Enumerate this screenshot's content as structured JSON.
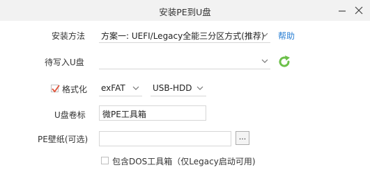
{
  "window": {
    "title": "安装PE到U盘",
    "minimize_glyph": "−",
    "close_glyph": "✕"
  },
  "install_method": {
    "label": "安装方法",
    "value": "方案一: UEFI/Legacy全能三分区方式(推荐)",
    "help": "帮助"
  },
  "target_usb": {
    "label": "待写入U盘",
    "value": "",
    "refresh_icon": "refresh-icon"
  },
  "format": {
    "label": "格式化",
    "checked": true,
    "filesystem": "exFAT",
    "mode": "USB-HDD"
  },
  "volume_label": {
    "label": "U盘卷标",
    "value": "微PE工具箱"
  },
  "wallpaper": {
    "label": "PE壁纸(可选)",
    "value": "",
    "browse": "..."
  },
  "dos_tools": {
    "checked": false,
    "label": "包含DOS工具箱（仅Legacy启动可用)"
  },
  "colors": {
    "accent": "#2a7fd4",
    "refresh": "#6cc04a",
    "checkmark": "#e0533a"
  }
}
